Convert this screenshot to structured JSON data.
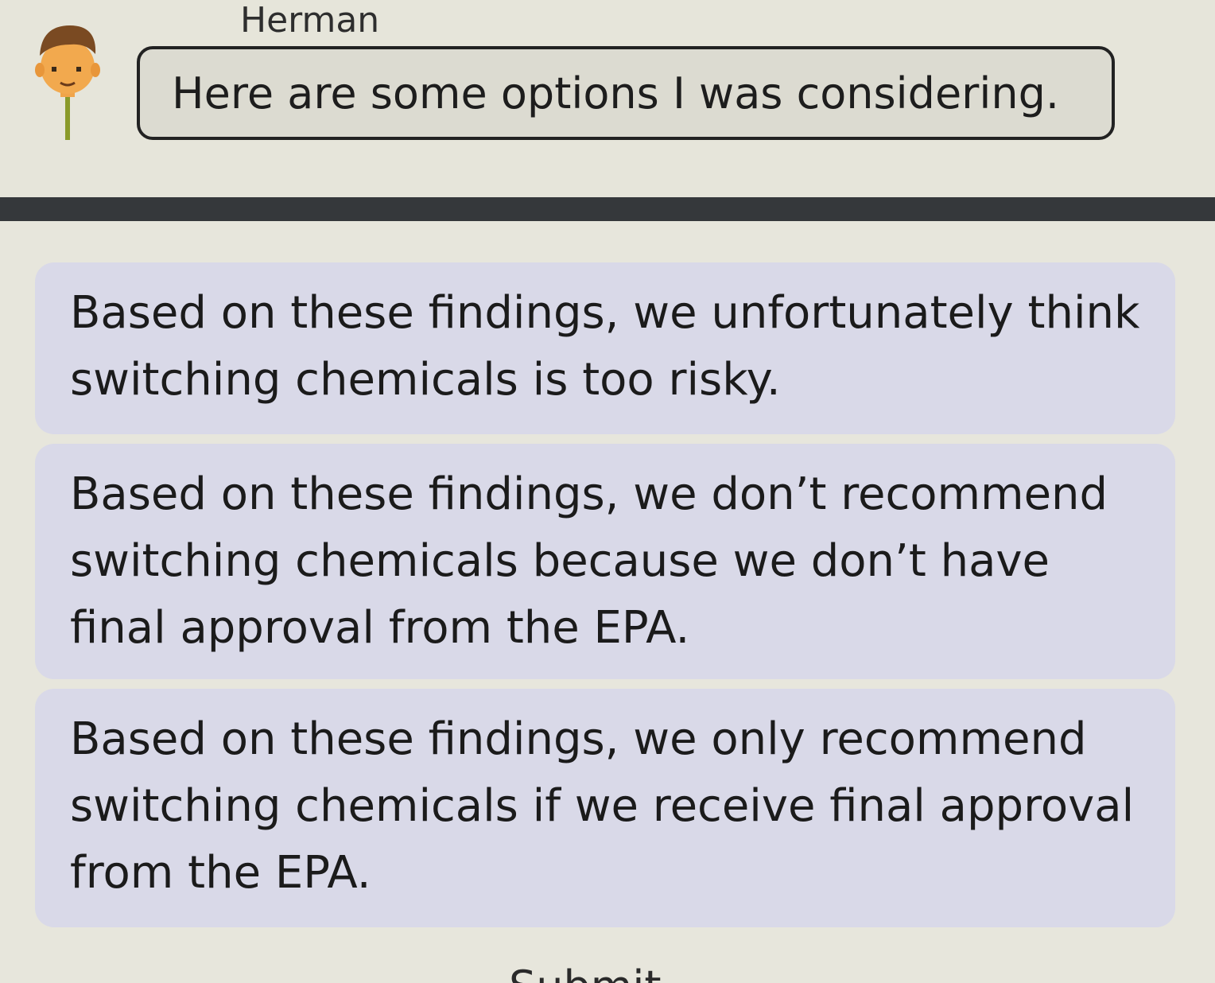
{
  "dialogue": {
    "speaker_name": "Herman",
    "message": "Here are some options I was considering."
  },
  "options": [
    {
      "text": "Based on these findings, we unfortunately think switching chemicals is too risky."
    },
    {
      "text": "Based on these findings, we don’t recommend switching chemicals because we don’t have final approval from the EPA."
    },
    {
      "text": "Based on these findings, we only recommend switching chemicals if we receive final approval from the EPA."
    }
  ],
  "footer": {
    "submit_label": "Submit"
  },
  "colors": {
    "background": "#e9e8dd",
    "divider": "#35383b",
    "option_card": "#d9d9e8",
    "bubble_border": "#222222"
  }
}
